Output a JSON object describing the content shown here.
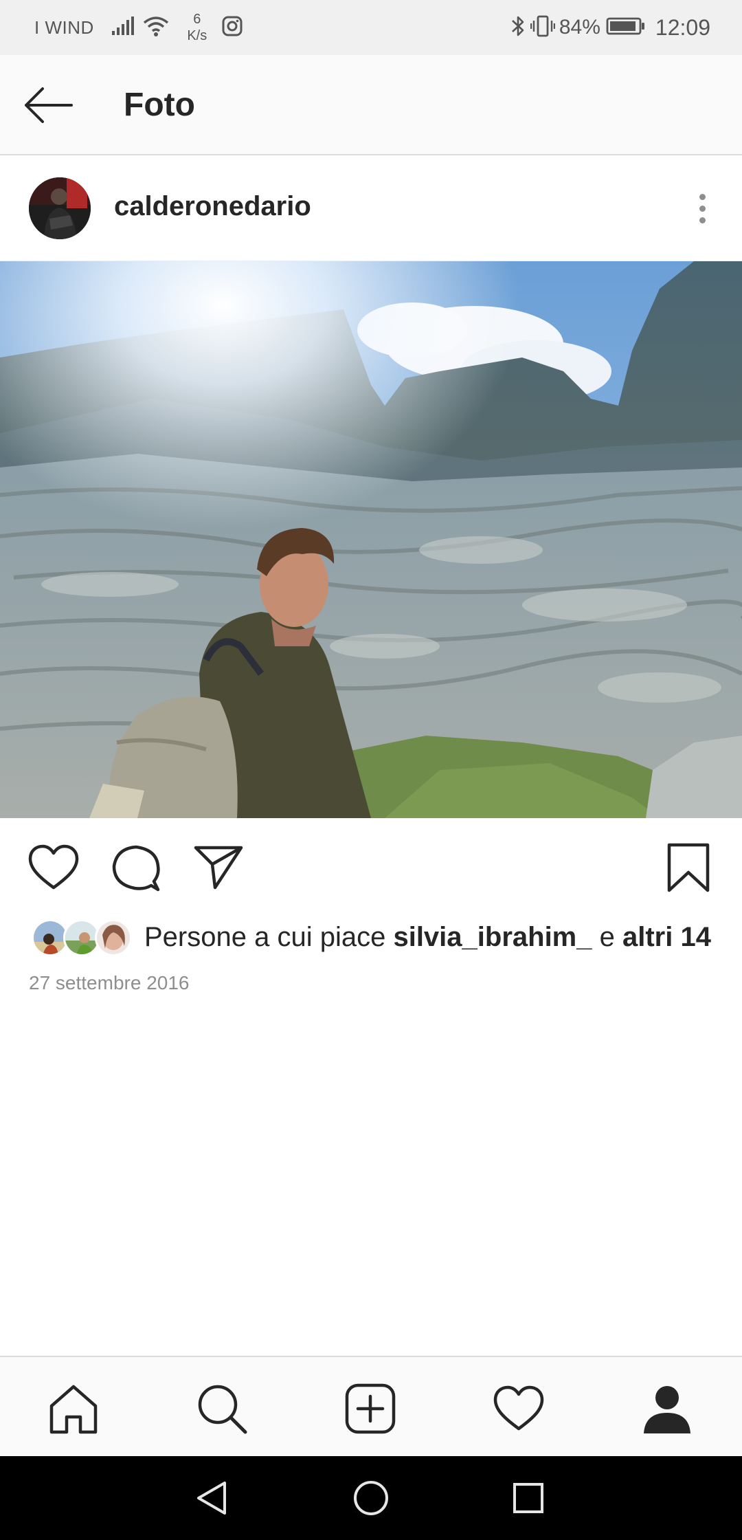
{
  "status_bar": {
    "carrier": "I WIND",
    "net_speed_value": "6",
    "net_speed_unit": "K/s",
    "battery_percent": "84%",
    "time": "12:09"
  },
  "app_bar": {
    "title": "Foto",
    "back_icon": "arrow-left-icon"
  },
  "post": {
    "username": "calderonedario",
    "more_icon": "more-vertical-icon",
    "actions": {
      "like_icon": "heart-icon",
      "comment_icon": "comment-icon",
      "share_icon": "send-icon",
      "save_icon": "bookmark-icon"
    },
    "likes": {
      "prefix": "Persone a cui piace",
      "first_liker": "silvia_ibrahim_",
      "joiner": "e",
      "others": "altri 14"
    },
    "date": "27 settembre 2016"
  },
  "bottom_nav": {
    "items": [
      {
        "icon": "home-icon"
      },
      {
        "icon": "search-icon"
      },
      {
        "icon": "add-post-icon"
      },
      {
        "icon": "activity-heart-icon"
      },
      {
        "icon": "profile-icon"
      }
    ]
  },
  "colors": {
    "text_primary": "#262626",
    "text_secondary": "#8e8e8e",
    "bar_background": "#fafafa",
    "divider": "#dbdbdb"
  }
}
